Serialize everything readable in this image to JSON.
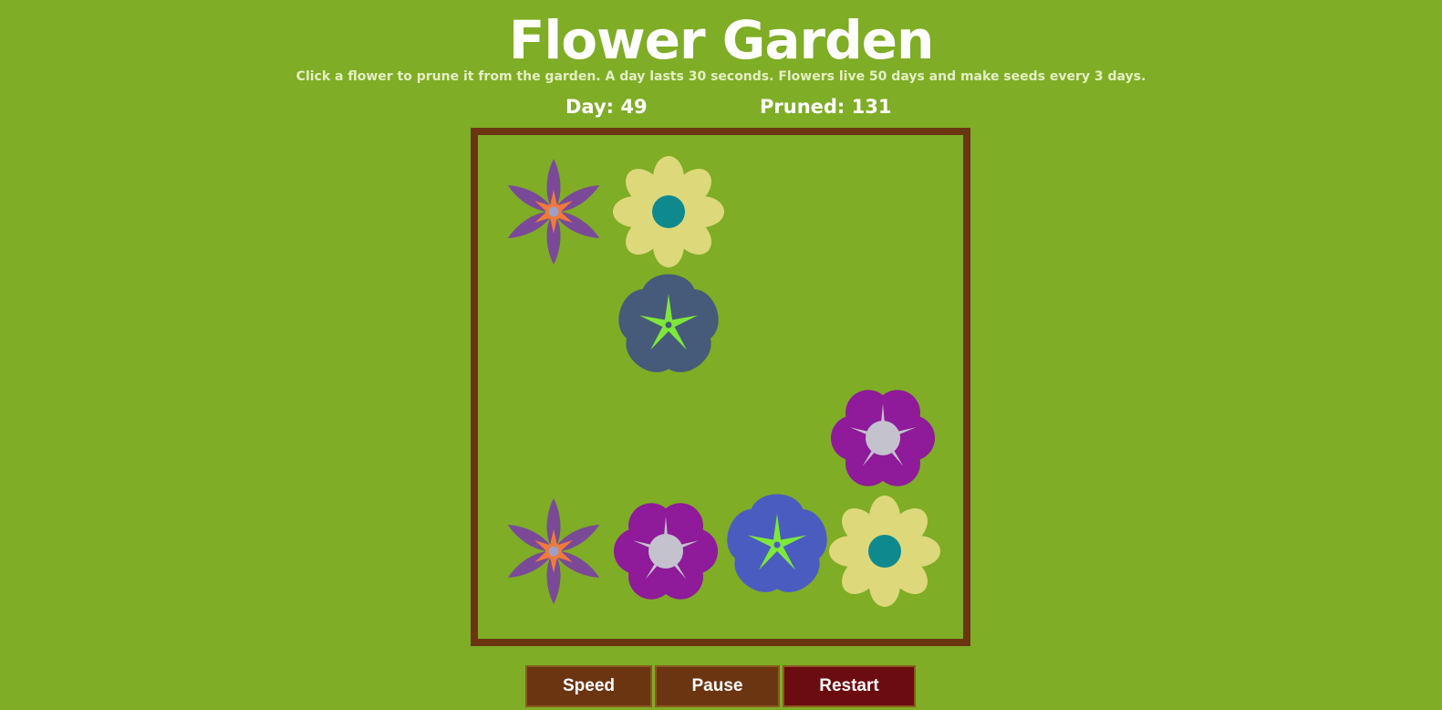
{
  "title": "Flower Garden",
  "subtitle": "Click a flower to prune it from the garden. A day lasts 30 seconds. Flowers live 50 days and make seeds every 3 days.",
  "stats": {
    "day": "Day: 49",
    "pruned": "Pruned: 131"
  },
  "buttons": {
    "speed": "Speed",
    "pause": "Pause",
    "restart": "Restart"
  },
  "colors": {
    "background": "#7fad26",
    "border": "#6b3512",
    "button": "#6b3512",
    "restart_button": "#6b0c10"
  },
  "garden": {
    "flowers": [
      {
        "type": "star",
        "petal": "#7a4a99",
        "center": "#f07a3a",
        "dot": "#9aa0c8"
      },
      {
        "type": "daisy",
        "petal": "#ddd87a",
        "center": "#0e8a8f"
      },
      {
        "type": "bell",
        "petal": "#465a7a",
        "center": "#7ee83a"
      },
      {
        "type": "rose",
        "petal": "#8f1a9a",
        "center": "#c4c2cc"
      },
      {
        "type": "star",
        "petal": "#7a4a99",
        "center": "#f07a3a",
        "dot": "#9aa0c8"
      },
      {
        "type": "rose",
        "petal": "#8f1a9a",
        "center": "#c4c2cc"
      },
      {
        "type": "bell",
        "petal": "#4a5cc0",
        "center": "#7ee83a"
      },
      {
        "type": "daisy",
        "petal": "#ddd87a",
        "center": "#0e8a8f"
      }
    ]
  }
}
